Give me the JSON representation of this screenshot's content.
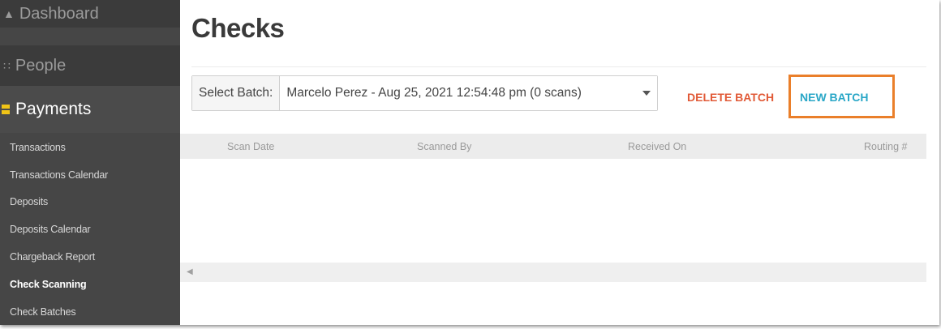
{
  "sidebar": {
    "dashboard": {
      "label": "Dashboard",
      "icon": "dashboard-icon"
    },
    "people": {
      "label": "People",
      "icon": "people-icon"
    },
    "payments": {
      "label": "Payments",
      "icon": "payments-icon"
    },
    "items": [
      {
        "label": "Transactions"
      },
      {
        "label": "Transactions Calendar"
      },
      {
        "label": "Deposits"
      },
      {
        "label": "Deposits Calendar"
      },
      {
        "label": "Chargeback Report"
      },
      {
        "label": "Check Scanning",
        "active": true
      },
      {
        "label": "Check Batches"
      }
    ]
  },
  "main": {
    "title": "Checks",
    "batch": {
      "label": "Select Batch:",
      "selected": "Marcelo Perez - Aug 25, 2021 12:54:48 pm (0 scans)"
    },
    "delete_label": "DELETE BATCH",
    "new_label": "NEW BATCH",
    "columns": [
      "Scan Date",
      "Scanned By",
      "Received On",
      "Routing #"
    ]
  },
  "colors": {
    "sidebar_bg": "#464646",
    "accent_yellow": "#f0c417",
    "delete_red": "#e15a37",
    "new_blue": "#2aa7c7",
    "highlight_orange": "#ea7f2a"
  }
}
